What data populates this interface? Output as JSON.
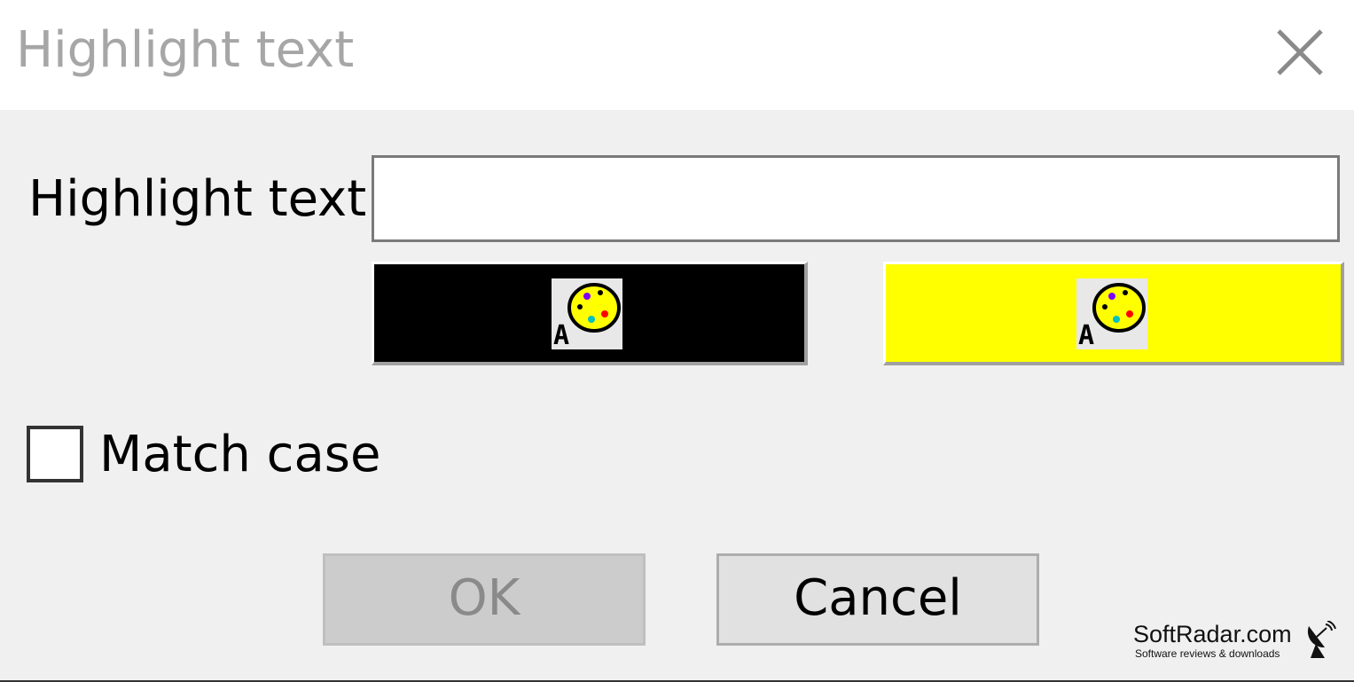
{
  "window": {
    "title": "Highlight text"
  },
  "form": {
    "highlight_label": "Highlight text:",
    "highlight_value": "",
    "foreground_color": "#000000",
    "background_color": "#ffff00",
    "color_button_icon": "palette-icon",
    "match_case_label": "Match case",
    "match_case_checked": false
  },
  "buttons": {
    "ok_label": "OK",
    "ok_enabled": false,
    "cancel_label": "Cancel"
  },
  "watermark": {
    "name": "SoftRadar.com",
    "tagline": "Software reviews & downloads"
  }
}
